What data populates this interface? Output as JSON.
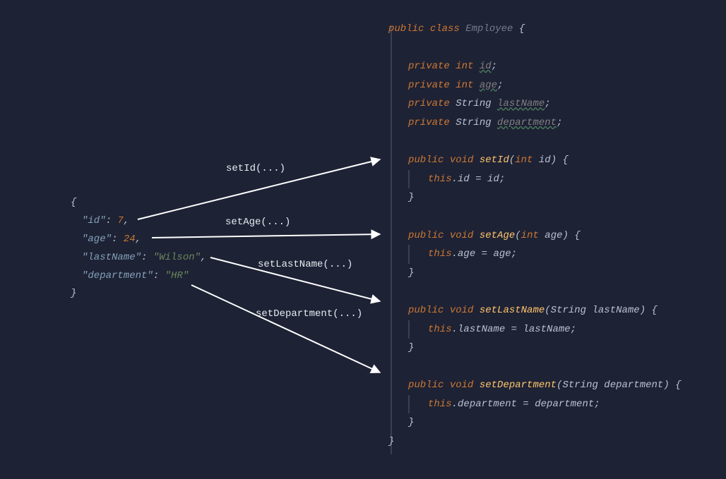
{
  "json": {
    "open": "{",
    "l1_key": "\"id\"",
    "l1_colon": ": ",
    "l1_val": "7",
    "l1_comma": ",",
    "l2_key": "\"age\"",
    "l2_colon": ": ",
    "l2_val": "24",
    "l2_comma": ",",
    "l3_key": "\"lastName\"",
    "l3_colon": ": ",
    "l3_val": "\"Wilson\"",
    "l3_comma": ",",
    "l4_key": "\"department\"",
    "l4_colon": ": ",
    "l4_val": "\"HR\"",
    "close": "}"
  },
  "labels": {
    "setId": "setId(...)",
    "setAge": "setAge(...)",
    "setLastName": "setLastName(...)",
    "setDepartment": "setDepartment(...)"
  },
  "java": {
    "kw_public": "public",
    "kw_class": "class",
    "classname": "Employee",
    "kw_private": "private",
    "kw_int": "int",
    "kw_void": "void",
    "kw_this": "this",
    "type_string": "String",
    "decl_open": " {",
    "decl_close": "}",
    "semi": ";",
    "dot": ".",
    "eq": " = ",
    "id_field": "id",
    "age_field": "age",
    "lastName_field": "lastName",
    "department_field": "department",
    "m_setId": "setId",
    "m_setAge": "setAge",
    "m_setLastName": "setLastName",
    "m_setDepartment": "setDepartment",
    "p_id": "id",
    "p_age": "age",
    "p_lastName": "lastName",
    "p_department": "department"
  }
}
